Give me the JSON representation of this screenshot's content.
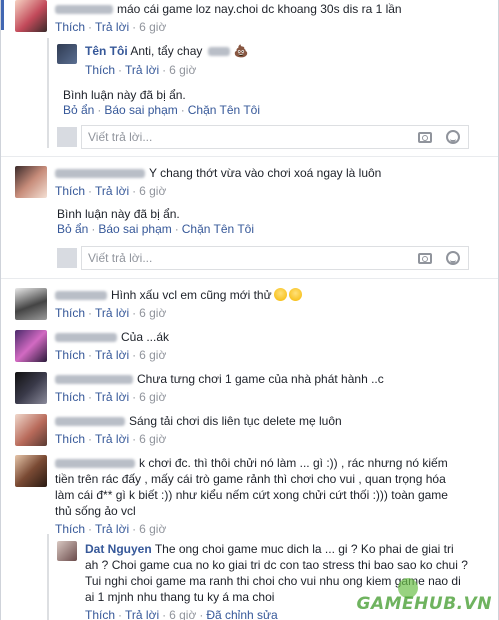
{
  "action_labels": {
    "like": "Thích",
    "reply": "Trả lời",
    "edit_history": "Đã chỉnh sửa"
  },
  "removed_notice": {
    "text": "Bình luận này đã bị ẩn.",
    "unhide": "Bỏ ẩn",
    "report": "Báo sai phạm",
    "block": "Chặn Tên Tôi"
  },
  "reply_input": {
    "placeholder": "Viết trả lời..."
  },
  "comments": [
    {
      "text": "máo cái game loz nay.choi dc khoang 30s dis ra 1 lần",
      "time": "6 giờ"
    },
    {
      "author": "Tên Tôi",
      "text": "Anti, tẩy chay ",
      "time": "6 giờ"
    },
    {
      "text": "Y chang thớt vừa vào chơi xoá ngay là luôn",
      "time": "6 giờ"
    },
    {
      "text": "Hình xấu vcl em cũng mới thử",
      "time": "6 giờ"
    },
    {
      "text": "Của ...ák",
      "time": "6 giờ"
    },
    {
      "text": "Chưa tưng chơi 1 game của nhà phát hành ..c",
      "time": "6 giờ"
    },
    {
      "text": "Sáng tải chơi dis liên tục delete mẹ luôn",
      "time": "6 giờ"
    },
    {
      "text": "k chơi đc. thì thôi chửi nó làm ... gì :)) , rác nhưng nó kiếm tiền trên rác đấy , mấy cái trò game rảnh thì chơi cho vui , quan trọng hóa làm cái đ** gì k biết :)) như kiểu nếm cứt xong chửi cứt thối :))) toàn game thủ sống ảo vcl",
      "time": "6 giờ"
    },
    {
      "author": "Dat Nguyen",
      "text": "The ong choi game muc dich la ... gi ? Ko phai de giai tri ah ? Choi game cua no ko giai tri dc con tao stress thi bao sao ko chui ? Tui nghi choi game ma ranh thi choi cho vui nhu ong kiem game nao di ai 1 mjnh nhu thang tu ky á ma choi",
      "time": "6 giờ"
    }
  ],
  "watermark": "GAMEHUB.VN"
}
